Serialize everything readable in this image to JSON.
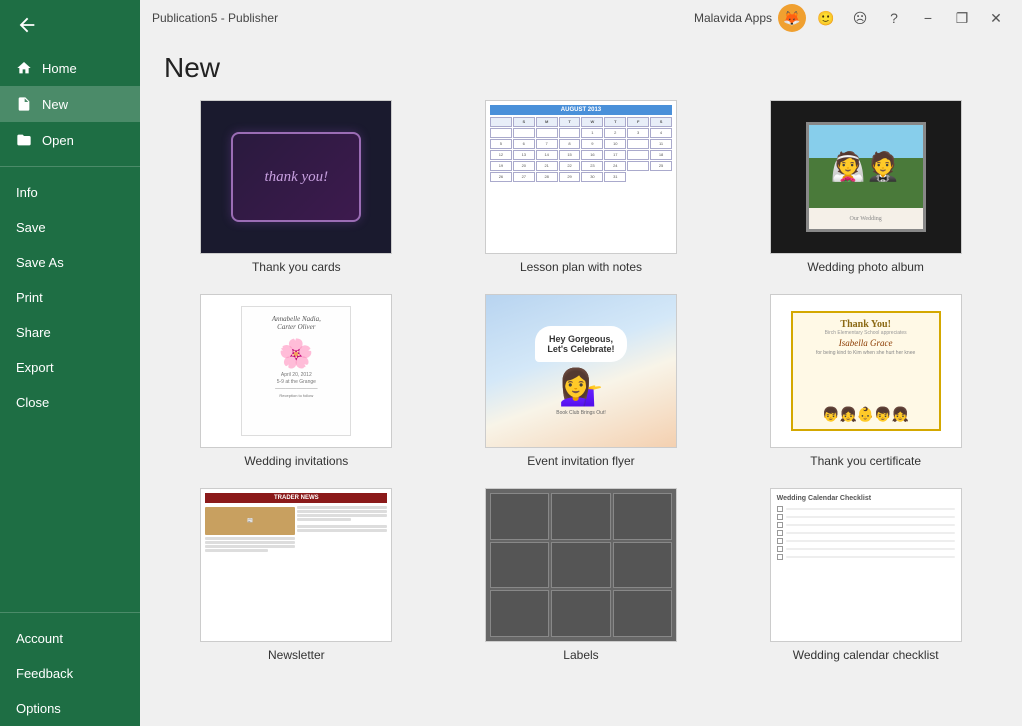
{
  "titlebar": {
    "title": "Publication5 - Publisher",
    "apps_label": "Malavida Apps",
    "min_label": "−",
    "restore_label": "❐",
    "close_label": "✕"
  },
  "sidebar": {
    "back_label": "",
    "items": [
      {
        "id": "home",
        "label": "Home",
        "icon": "home"
      },
      {
        "id": "new",
        "label": "New",
        "icon": "new",
        "active": true
      },
      {
        "id": "open",
        "label": "Open",
        "icon": "open"
      }
    ],
    "divider1": true,
    "text_items": [
      {
        "id": "info",
        "label": "Info"
      },
      {
        "id": "save",
        "label": "Save"
      },
      {
        "id": "saveas",
        "label": "Save As"
      },
      {
        "id": "print",
        "label": "Print"
      },
      {
        "id": "share",
        "label": "Share"
      },
      {
        "id": "export",
        "label": "Export"
      },
      {
        "id": "close",
        "label": "Close"
      }
    ],
    "divider2": true,
    "bottom_items": [
      {
        "id": "account",
        "label": "Account"
      },
      {
        "id": "feedback",
        "label": "Feedback"
      },
      {
        "id": "options",
        "label": "Options"
      }
    ]
  },
  "main": {
    "heading": "New",
    "templates": [
      {
        "id": "thankyou-cards",
        "label": "Thank you cards",
        "thumb_type": "thankyou"
      },
      {
        "id": "lesson-plan",
        "label": "Lesson plan with notes",
        "thumb_type": "lesson"
      },
      {
        "id": "wedding-album",
        "label": "Wedding photo album",
        "thumb_type": "wedding"
      },
      {
        "id": "wedding-invitations",
        "label": "Wedding invitations",
        "thumb_type": "invite"
      },
      {
        "id": "event-flyer",
        "label": "Event invitation flyer",
        "thumb_type": "event"
      },
      {
        "id": "thankyou-cert",
        "label": "Thank you certificate",
        "thumb_type": "cert"
      },
      {
        "id": "newsletter",
        "label": "Newsletter",
        "thumb_type": "newsletter"
      },
      {
        "id": "labels",
        "label": "Labels",
        "thumb_type": "labels"
      },
      {
        "id": "checklist",
        "label": "Wedding calendar checklist",
        "thumb_type": "checklist"
      }
    ]
  }
}
